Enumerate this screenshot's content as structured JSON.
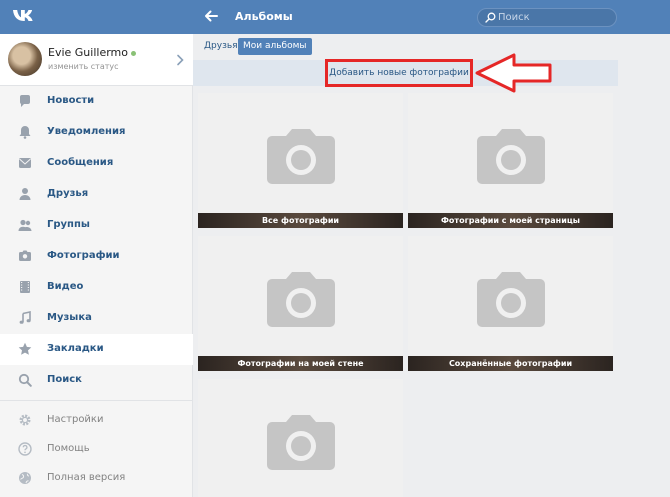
{
  "header": {
    "logo": "vk-logo-icon",
    "title": "Альбомы",
    "search_placeholder": "Поиск"
  },
  "profile": {
    "name": "Evie Guillermo",
    "status": "изменить статус"
  },
  "sidebar": {
    "items": [
      {
        "label": "Новости",
        "icon": "news-icon"
      },
      {
        "label": "Уведомления",
        "icon": "bell-icon"
      },
      {
        "label": "Сообщения",
        "icon": "message-icon"
      },
      {
        "label": "Друзья",
        "icon": "user-icon"
      },
      {
        "label": "Группы",
        "icon": "group-icon"
      },
      {
        "label": "Фотографии",
        "icon": "camera-icon"
      },
      {
        "label": "Видео",
        "icon": "film-icon"
      },
      {
        "label": "Музыка",
        "icon": "music-icon"
      },
      {
        "label": "Закладки",
        "icon": "star-icon"
      },
      {
        "label": "Поиск",
        "icon": "search-icon"
      }
    ],
    "secondary": [
      {
        "label": "Настройки",
        "icon": "gear-icon"
      },
      {
        "label": "Помощь",
        "icon": "help-icon"
      },
      {
        "label": "Полная версия",
        "icon": "globe-icon"
      }
    ]
  },
  "tabs": [
    {
      "label": "Друзья",
      "active": false
    },
    {
      "label": "Мои альбомы",
      "active": true
    }
  ],
  "add_photos_label": "Добавить новые фотографии",
  "albums": [
    {
      "caption": "Все фотографии"
    },
    {
      "caption": "Фотографии с моей страницы"
    },
    {
      "caption": "Фотографии на моей стене"
    },
    {
      "caption": "Сохранённые фотографии"
    },
    {
      "caption": ""
    }
  ],
  "colors": {
    "header": "#5181b8",
    "link": "#2a5885",
    "highlight": "#e52727"
  }
}
